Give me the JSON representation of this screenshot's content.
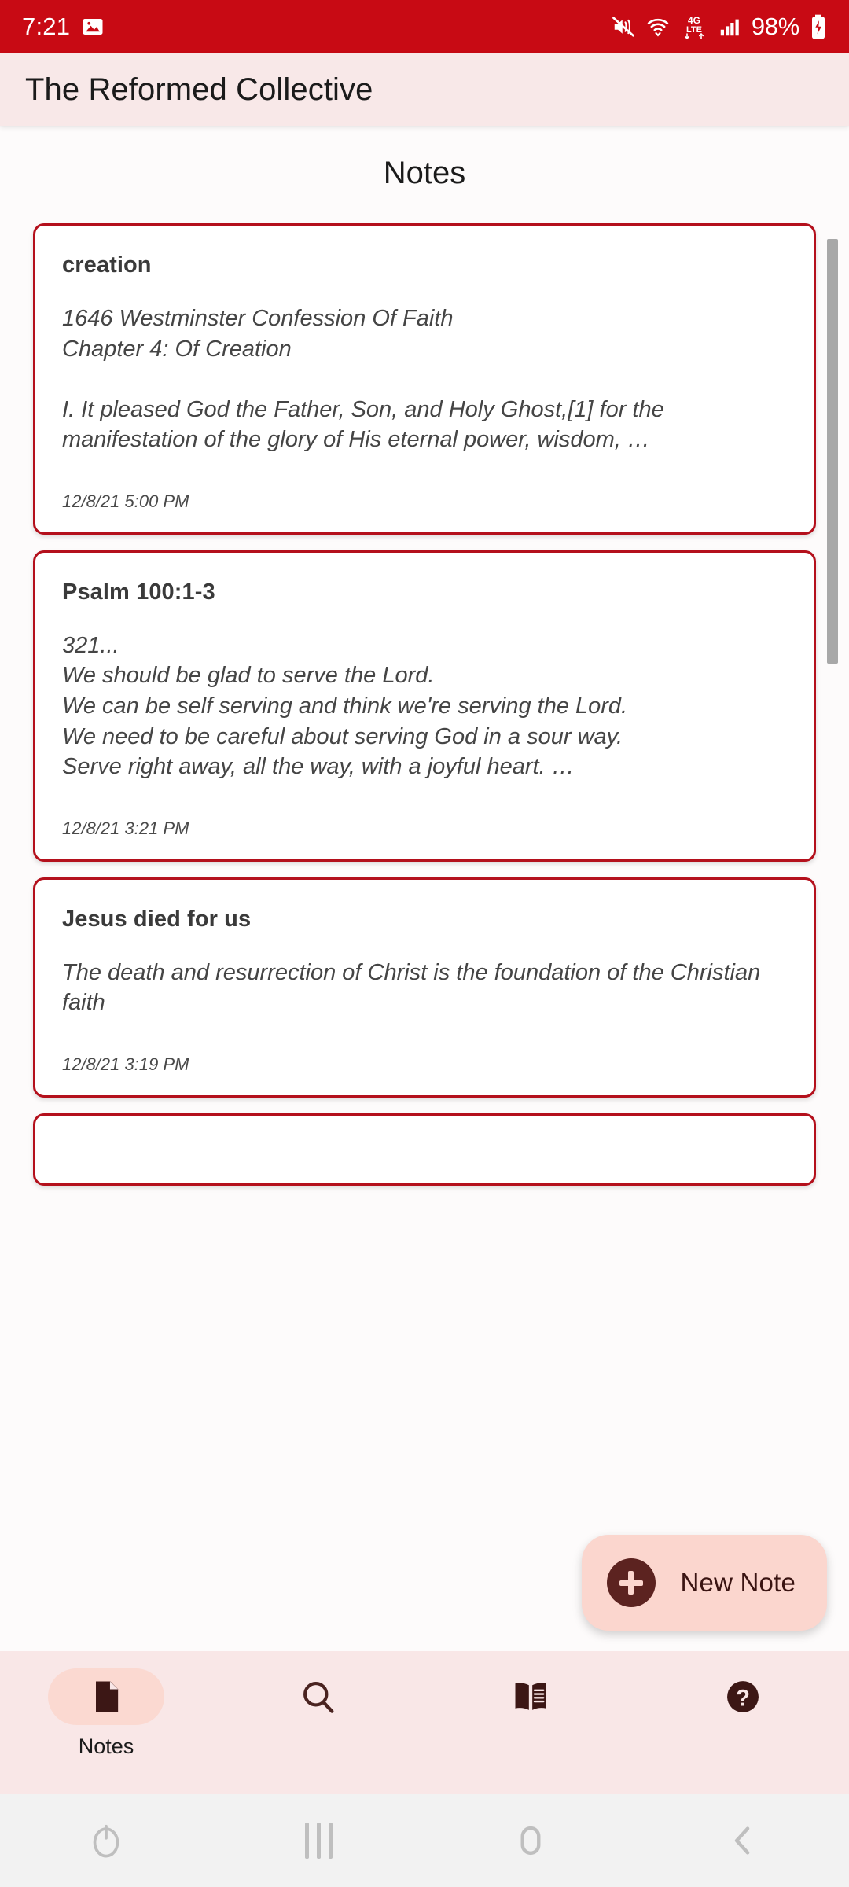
{
  "status_bar": {
    "time": "7:21",
    "battery_text": "98%",
    "icons": [
      "image-icon",
      "mute-icon",
      "wifi-icon",
      "4g-lte-icon",
      "signal-icon",
      "battery-charging-icon"
    ],
    "network_label_top": "4G",
    "network_label_bottom": "LTE",
    "background_color": "#C80A14"
  },
  "app_bar": {
    "title": "The Reformed Collective",
    "background_color": "#F8E8E8"
  },
  "page": {
    "title": "Notes"
  },
  "notes": [
    {
      "title": "creation",
      "body": "1646 Westminster Confession Of Faith\nChapter 4: Of Creation\n\nI. It pleased God the Father, Son, and Holy Ghost,[1] for the manifestation of the glory of His eternal power, wisdom, …",
      "timestamp": "12/8/21 5:00 PM"
    },
    {
      "title": "Psalm 100:1-3",
      "body": "321...\nWe should be glad to serve the Lord.\nWe can be self serving and think we're serving the Lord.\nWe need to be careful about serving God in a sour way.\nServe right away, all the way, with a joyful heart. …",
      "timestamp": "12/8/21 3:21 PM"
    },
    {
      "title": "Jesus died for us",
      "body": "The death and resurrection of Christ is the foundation of the Christian faith",
      "timestamp": "12/8/21 3:19 PM"
    },
    {
      "title": "",
      "body": "",
      "timestamp": ""
    }
  ],
  "fab": {
    "label": "New Note",
    "icon": "plus-icon",
    "background_color": "#FBD6CE",
    "icon_color": "#5C2320"
  },
  "bottom_nav": {
    "items": [
      {
        "label": "Notes",
        "icon": "note-document-icon",
        "active": true
      },
      {
        "label": "",
        "icon": "search-icon",
        "active": false
      },
      {
        "label": "",
        "icon": "book-icon",
        "active": false
      },
      {
        "label": "",
        "icon": "help-question-icon",
        "active": false
      }
    ],
    "background_color": "#F9E7E7"
  },
  "system_nav": {
    "items": [
      "power-icon",
      "recents-icon",
      "home-icon",
      "back-icon"
    ],
    "background_color": "#F2F2F2"
  },
  "theme": {
    "card_border": "#B4101C",
    "accent_red": "#C80A14",
    "pink_surface": "#F8E8E8"
  }
}
